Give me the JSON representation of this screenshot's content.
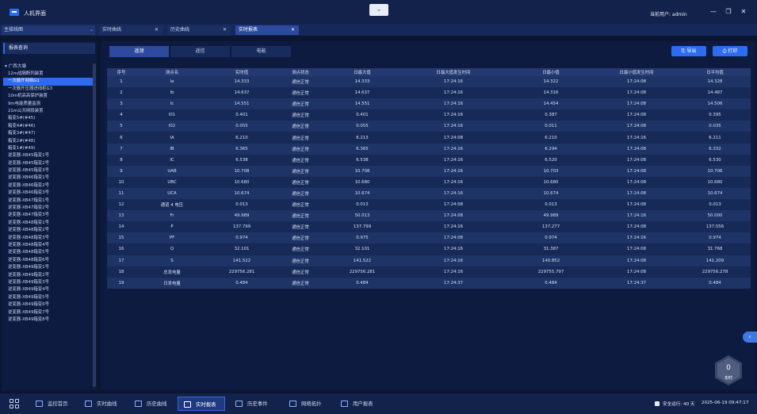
{
  "window": {
    "title": "人机界面",
    "collapse_glyph": "⌄",
    "current_user": "当前用户: admin",
    "minimize_glyph": "—",
    "maximize_glyph": "❐",
    "close_glyph": "✕"
  },
  "topbar": {
    "diagram_select": "主接线图",
    "select_arrow": "⌄",
    "close_glyph": "✕",
    "tabs": [
      {
        "label": "实时曲线"
      },
      {
        "label": "历史曲线"
      },
      {
        "label": "实时报表"
      }
    ]
  },
  "sidebar": {
    "header": "报表查询",
    "root": "▾ 广西大塘",
    "items": [
      "12m战隔断列装置",
      "一次融开网络G1",
      "一次融开压器进线柜G3",
      "10m机高高保护装置",
      "9m电能质量监测",
      "21m公共网段装置",
      "箱变5#(#45)",
      "箱变4#(#46)",
      "箱变3#(#47)",
      "箱变2#(#48)",
      "箱变1#(#49)",
      "逆变器-XB45箱变1号",
      "逆变器-XB45箱变2号",
      "逆变器-XB45箱变3号",
      "逆变器-XB46箱变1号",
      "逆变器-XB46箱变2号",
      "逆变器-XB46箱变3号",
      "逆变器-XB47箱变1号",
      "逆变器-XB47箱变2号",
      "逆变器-XB47箱变3号",
      "逆变器-XB48箱变1号",
      "逆变器-XB48箱变2号",
      "逆变器-XB48箱变3号",
      "逆变器-XB48箱变4号",
      "逆变器-XB48箱变5号",
      "逆变器-XB48箱变6号",
      "逆变器-XB49箱变1号",
      "逆变器-XB49箱变2号",
      "逆变器-XB49箱变3号",
      "逆变器-XB49箱变4号",
      "逆变器-XB49箱变5号",
      "逆变器-XB49箱变6号",
      "逆变器-XB49箱变7号",
      "逆变器-XB49箱变8号"
    ],
    "selected_index": 1
  },
  "main": {
    "sub_tabs": [
      "遥测",
      "遥信",
      "电能"
    ],
    "active_sub_tab": 0,
    "export_label": "⎘ 导出",
    "print_label": "⎙ 打印",
    "columns": [
      "序号",
      "测点名",
      "实时值",
      "测点状态",
      "日最大值",
      "日最大值发生时间",
      "日最小值",
      "日最小值发生时间",
      "日平均值"
    ],
    "rows": [
      [
        "1",
        "Ia",
        "14.333",
        "通信正常",
        "14.333",
        "17:24:16",
        "14.322",
        "17:24:08",
        "14.328"
      ],
      [
        "2",
        "Ib",
        "14.637",
        "通信正常",
        "14.637",
        "17:24:16",
        "14.316",
        "17:24:08",
        "14.487"
      ],
      [
        "3",
        "Ic",
        "14.551",
        "通信正常",
        "14.551",
        "17:24:16",
        "14.454",
        "17:24:08",
        "14.506"
      ],
      [
        "4",
        "I01",
        "0.401",
        "通信正常",
        "0.401",
        "17:24:16",
        "0.387",
        "17:24:08",
        "0.395"
      ],
      [
        "5",
        "I02",
        "0.055",
        "通信正常",
        "0.055",
        "17:24:16",
        "0.011",
        "17:24:08",
        "0.035"
      ],
      [
        "6",
        "IA",
        "6.210",
        "通信正常",
        "6.213",
        "17:24:08",
        "6.210",
        "17:24:16",
        "6.211"
      ],
      [
        "7",
        "IB",
        "6.365",
        "通信正常",
        "6.365",
        "17:24:16",
        "6.294",
        "17:24:08",
        "6.332"
      ],
      [
        "8",
        "IC",
        "6.538",
        "通信正常",
        "6.538",
        "17:24:16",
        "6.520",
        "17:24:08",
        "6.530"
      ],
      [
        "9",
        "UAB",
        "10.708",
        "通信正常",
        "10.708",
        "17:24:16",
        "10.703",
        "17:24:08",
        "10.706"
      ],
      [
        "10",
        "UBC",
        "10.680",
        "通信正常",
        "10.680",
        "17:24:16",
        "10.680",
        "17:24:08",
        "10.680"
      ],
      [
        "11",
        "UCA",
        "10.674",
        "通信正常",
        "10.674",
        "17:24:16",
        "10.674",
        "17:24:08",
        "10.674"
      ],
      [
        "12",
        "通道 4 电压",
        "0.013",
        "通信正常",
        "0.013",
        "17:24:08",
        "0.013",
        "17:24:08",
        "0.013"
      ],
      [
        "13",
        "Fr",
        "49.989",
        "通信正常",
        "50.013",
        "17:24:08",
        "49.989",
        "17:24:16",
        "50.000"
      ],
      [
        "14",
        "P",
        "137.799",
        "通信正常",
        "137.799",
        "17:24:16",
        "137.277",
        "17:24:08",
        "137.556"
      ],
      [
        "15",
        "PF",
        "0.974",
        "通信正常",
        "0.975",
        "17:24:08",
        "0.974",
        "17:24:16",
        "0.974"
      ],
      [
        "16",
        "Q",
        "32.101",
        "通信正常",
        "32.101",
        "17:24:16",
        "31.387",
        "17:24:08",
        "31.768"
      ],
      [
        "17",
        "S",
        "141.522",
        "通信正常",
        "141.522",
        "17:24:16",
        "140.852",
        "17:24:08",
        "141.209"
      ],
      [
        "18",
        "总发电量",
        "229756.281",
        "通信正常",
        "229756.281",
        "17:24:16",
        "229755.797",
        "17:24:08",
        "229756.278"
      ],
      [
        "19",
        "日发电量",
        "0.484",
        "通信正常",
        "0.484",
        "17:24:37",
        "0.484",
        "17:24:37",
        "0.484"
      ]
    ]
  },
  "badge": {
    "count": "0",
    "label": "实时"
  },
  "edge_toggle": "‹",
  "bottombar": {
    "nav": [
      {
        "label": "监控首页",
        "icon": "home-icon"
      },
      {
        "label": "实时曲线",
        "icon": "realtime-curve-icon"
      },
      {
        "label": "历史曲线",
        "icon": "history-curve-icon"
      },
      {
        "label": "实时报表",
        "icon": "realtime-report-icon"
      },
      {
        "label": "历史事件",
        "icon": "history-event-icon"
      },
      {
        "label": "网络拓扑",
        "icon": "network-topology-icon"
      },
      {
        "label": "用户报表",
        "icon": "user-report-icon"
      }
    ],
    "active_index": 3,
    "uptime": "安全运行: 40 天",
    "clock": "2025-06-19 09:47:17"
  },
  "colors": {
    "background": "#0b1633",
    "accent": "#2d6cf0",
    "row_odd": "#1e3366",
    "row_even": "#172a57"
  }
}
